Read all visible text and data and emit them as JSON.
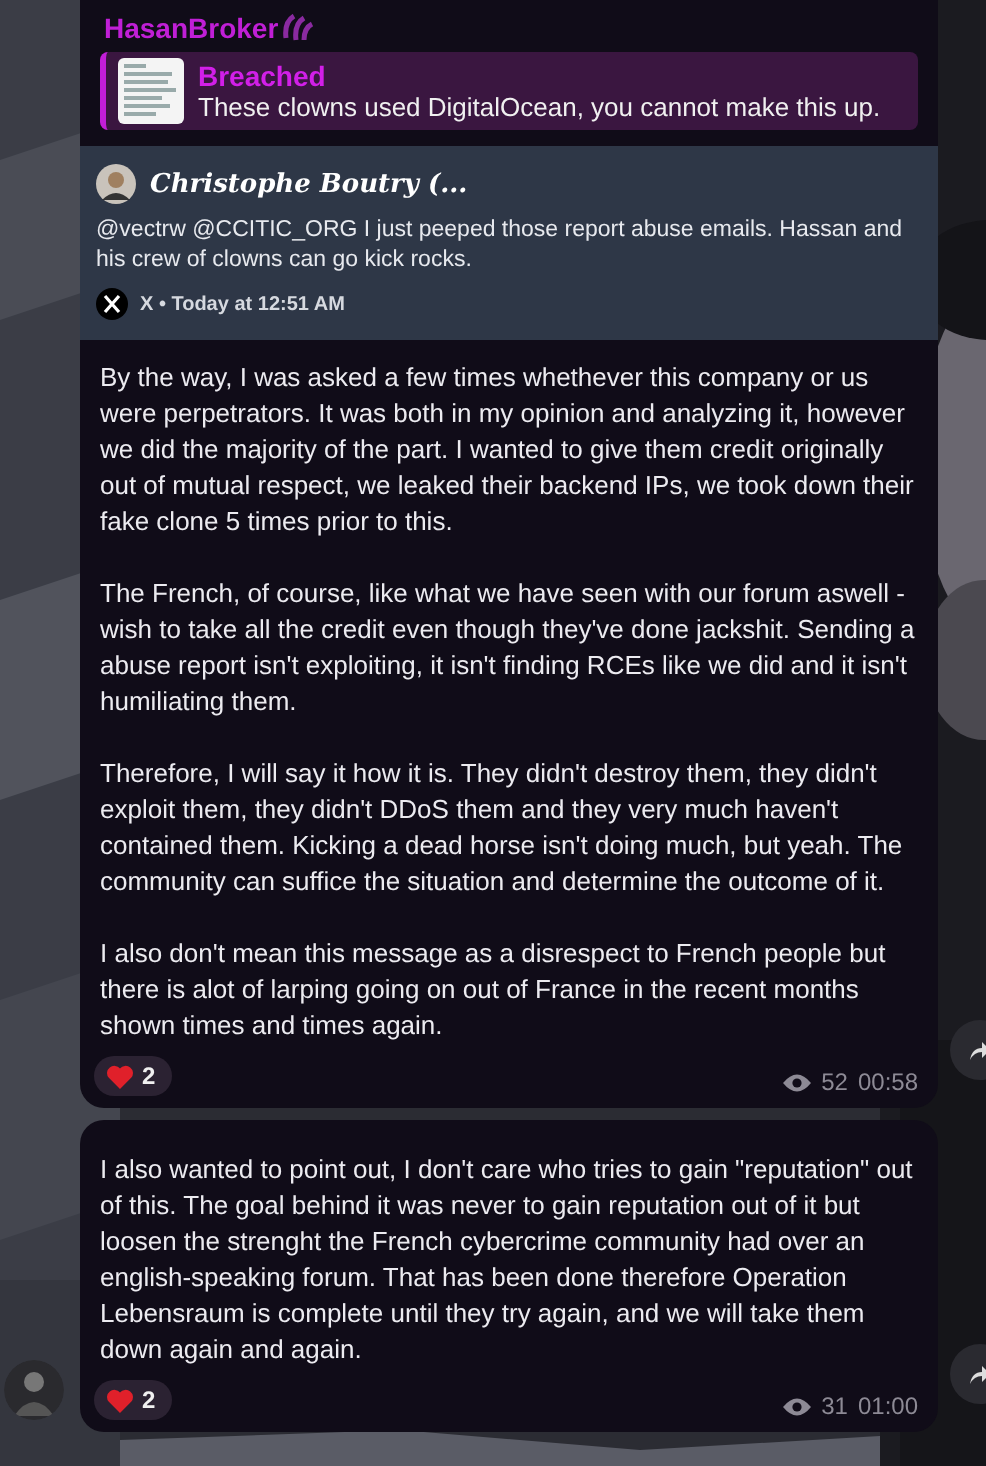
{
  "messages": [
    {
      "author": "HasanBroker",
      "reply": {
        "title": "Breached",
        "text": "These clowns used DigitalOcean, you cannot make this up."
      },
      "embed": {
        "author": "Christophe Boutry (...",
        "text": "@vectrw @CCITIC_ORG I just peeped those report abuse emails. Hassan and his crew of clowns can go kick rocks.",
        "source": "X • Today at 12:51 AM"
      },
      "paragraphs": [
        "By the way, I was asked a few times whethever this company or us were perpetrators. It was both in my opinion and analyzing it, however we did the majority of the part. I wanted to give them credit originally out of mutual respect, we leaked their backend IPs, we took down their fake clone 5 times prior to this.",
        "The French, of course, like what we have seen with our forum aswell - wish to take all the credit even though they've done jackshit. Sending a abuse report isn't exploiting, it isn't finding RCEs like we did and it isn't humiliating them.",
        "Therefore, I will say it how it is. They didn't destroy them, they didn't exploit them, they didn't DDoS them and they very much haven't contained them. Kicking a dead horse isn't doing much, but yeah. The community can suffice the situation and determine the outcome of it.",
        "I also don't mean this message as a disrespect to French people but there is alot of larping going on out of France in the recent months shown times and times again."
      ],
      "reaction": {
        "count": "2"
      },
      "views": "52",
      "time": "00:58",
      "avatar": false
    },
    {
      "paragraphs": [
        "I also wanted to point out, I don't care who tries to gain \"reputation\" out of this. The goal behind it was never to gain reputation out of it but loosen the strenght the French cybercrime community had over an english-speaking forum. That has been done therefore Operation Lebensraum is complete until they try again, and we will take them down again and again."
      ],
      "reaction": {
        "count": "2"
      },
      "views": "31",
      "time": "01:00",
      "avatar": true
    }
  ]
}
